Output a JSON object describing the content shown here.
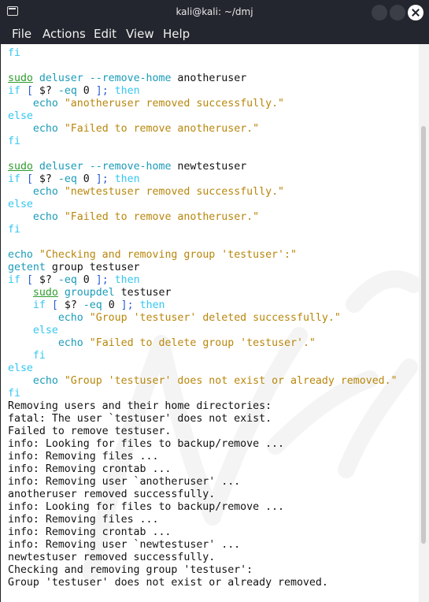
{
  "window": {
    "title": "kali@kali: ~/dmj",
    "app_icon": "terminal-icon",
    "buttons": [
      "minimize-icon",
      "maximize-icon",
      "close-icon"
    ]
  },
  "menu": [
    "File",
    "Actions",
    "Edit",
    "View",
    "Help"
  ],
  "colors": {
    "keyword": "#33c6f2",
    "command": "#1a9bb8",
    "sudo": "#2e9d2e",
    "string": "#b8860b",
    "operator": "#2b5bd6",
    "titlebar": "#23262e"
  },
  "terminal": {
    "lines": [
      [
        {
          "t": "fi",
          "c": "kw"
        }
      ],
      [],
      [
        {
          "t": "sudo",
          "c": "ok"
        },
        {
          "t": " "
        },
        {
          "t": "deluser",
          "c": "cmd"
        },
        {
          "t": " "
        },
        {
          "t": "--remove-home",
          "c": "cmd"
        },
        {
          "t": " anotheruser"
        }
      ],
      [
        {
          "t": "if",
          "c": "kw"
        },
        {
          "t": " "
        },
        {
          "t": "[",
          "c": "op"
        },
        {
          "t": " $? "
        },
        {
          "t": "-eq",
          "c": "cmd"
        },
        {
          "t": " 0 "
        },
        {
          "t": "];",
          "c": "op"
        },
        {
          "t": " "
        },
        {
          "t": "then",
          "c": "kw"
        }
      ],
      [
        {
          "t": "    "
        },
        {
          "t": "echo",
          "c": "cmd"
        },
        {
          "t": " "
        },
        {
          "t": "\"anotheruser removed successfully.\"",
          "c": "str"
        }
      ],
      [
        {
          "t": "else",
          "c": "kw"
        }
      ],
      [
        {
          "t": "    "
        },
        {
          "t": "echo",
          "c": "cmd"
        },
        {
          "t": " "
        },
        {
          "t": "\"Failed to remove anotheruser.\"",
          "c": "str"
        }
      ],
      [
        {
          "t": "fi",
          "c": "kw"
        }
      ],
      [],
      [
        {
          "t": "sudo",
          "c": "ok"
        },
        {
          "t": " "
        },
        {
          "t": "deluser",
          "c": "cmd"
        },
        {
          "t": " "
        },
        {
          "t": "--remove-home",
          "c": "cmd"
        },
        {
          "t": " newtestuser"
        }
      ],
      [
        {
          "t": "if",
          "c": "kw"
        },
        {
          "t": " "
        },
        {
          "t": "[",
          "c": "op"
        },
        {
          "t": " $? "
        },
        {
          "t": "-eq",
          "c": "cmd"
        },
        {
          "t": " 0 "
        },
        {
          "t": "];",
          "c": "op"
        },
        {
          "t": " "
        },
        {
          "t": "then",
          "c": "kw"
        }
      ],
      [
        {
          "t": "    "
        },
        {
          "t": "echo",
          "c": "cmd"
        },
        {
          "t": " "
        },
        {
          "t": "\"newtestuser removed successfully.\"",
          "c": "str"
        }
      ],
      [
        {
          "t": "else",
          "c": "kw"
        }
      ],
      [
        {
          "t": "    "
        },
        {
          "t": "echo",
          "c": "cmd"
        },
        {
          "t": " "
        },
        {
          "t": "\"Failed to remove anotheruser.\"",
          "c": "str"
        }
      ],
      [
        {
          "t": "fi",
          "c": "kw"
        }
      ],
      [],
      [
        {
          "t": "echo",
          "c": "cmd"
        },
        {
          "t": " "
        },
        {
          "t": "\"Checking and removing group 'testuser':\"",
          "c": "str"
        }
      ],
      [
        {
          "t": "getent",
          "c": "cmd"
        },
        {
          "t": " group testuser"
        }
      ],
      [
        {
          "t": "if",
          "c": "kw"
        },
        {
          "t": " "
        },
        {
          "t": "[",
          "c": "op"
        },
        {
          "t": " $? "
        },
        {
          "t": "-eq",
          "c": "cmd"
        },
        {
          "t": " 0 "
        },
        {
          "t": "];",
          "c": "op"
        },
        {
          "t": " "
        },
        {
          "t": "then",
          "c": "kw"
        }
      ],
      [
        {
          "t": "    "
        },
        {
          "t": "sudo",
          "c": "ok"
        },
        {
          "t": " "
        },
        {
          "t": "groupdel",
          "c": "cmd"
        },
        {
          "t": " testuser"
        }
      ],
      [
        {
          "t": "    "
        },
        {
          "t": "if",
          "c": "kw"
        },
        {
          "t": " "
        },
        {
          "t": "[",
          "c": "op"
        },
        {
          "t": " $? "
        },
        {
          "t": "-eq",
          "c": "cmd"
        },
        {
          "t": " 0 "
        },
        {
          "t": "];",
          "c": "op"
        },
        {
          "t": " "
        },
        {
          "t": "then",
          "c": "kw"
        }
      ],
      [
        {
          "t": "        "
        },
        {
          "t": "echo",
          "c": "cmd"
        },
        {
          "t": " "
        },
        {
          "t": "\"Group 'testuser' deleted successfully.\"",
          "c": "str"
        }
      ],
      [
        {
          "t": "    "
        },
        {
          "t": "else",
          "c": "kw"
        }
      ],
      [
        {
          "t": "        "
        },
        {
          "t": "echo",
          "c": "cmd"
        },
        {
          "t": " "
        },
        {
          "t": "\"Failed to delete group 'testuser'.\"",
          "c": "str"
        }
      ],
      [
        {
          "t": "    "
        },
        {
          "t": "fi",
          "c": "kw"
        }
      ],
      [
        {
          "t": "else",
          "c": "kw"
        }
      ],
      [
        {
          "t": "    "
        },
        {
          "t": "echo",
          "c": "cmd"
        },
        {
          "t": " "
        },
        {
          "t": "\"Group 'testuser' does not exist or already removed.\"",
          "c": "str"
        }
      ],
      [
        {
          "t": "fi",
          "c": "kw"
        }
      ],
      [
        {
          "t": "Removing users and their home directories:"
        }
      ],
      [
        {
          "t": "fatal: The user `testuser' does not exist."
        }
      ],
      [
        {
          "t": "Failed to remove testuser."
        }
      ],
      [
        {
          "t": "info: Looking for files to backup/remove ..."
        }
      ],
      [
        {
          "t": "info: Removing files ..."
        }
      ],
      [
        {
          "t": "info: Removing crontab ..."
        }
      ],
      [
        {
          "t": "info: Removing user `anotheruser' ..."
        }
      ],
      [
        {
          "t": "anotheruser removed successfully."
        }
      ],
      [
        {
          "t": "info: Looking for files to backup/remove ..."
        }
      ],
      [
        {
          "t": "info: Removing files ..."
        }
      ],
      [
        {
          "t": "info: Removing crontab ..."
        }
      ],
      [
        {
          "t": "info: Removing user `newtestuser' ..."
        }
      ],
      [
        {
          "t": "newtestuser removed successfully."
        }
      ],
      [
        {
          "t": "Checking and removing group 'testuser':"
        }
      ],
      [
        {
          "t": "Group 'testuser' does not exist or already removed."
        }
      ]
    ]
  }
}
